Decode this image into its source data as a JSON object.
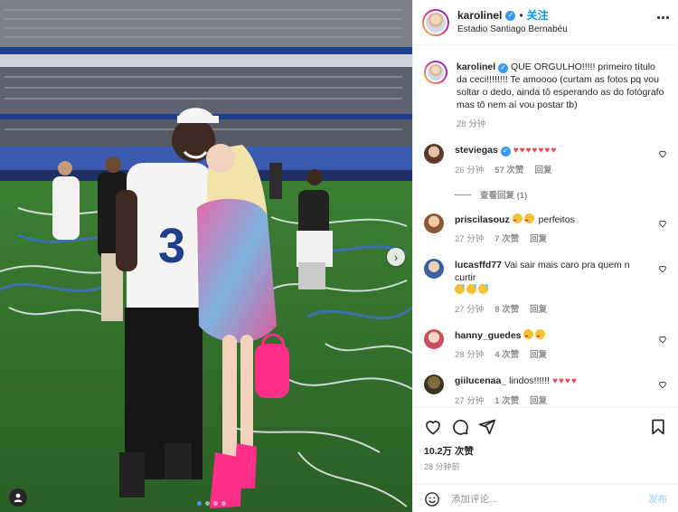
{
  "post": {
    "username": "karolinel",
    "follow_label": "关注",
    "separator": "•",
    "location": "Estadio Santiago Bernabéu"
  },
  "caption": {
    "username": "karolinel",
    "text": "QUE ORGULHO!!!!! primeiro título da ceci!!!!!!!! Te amoooo (curtam as fotos pq vou soltar o dedo, ainda tô esperando as do fotógrafo mas tô nem aí vou postar tb)",
    "time": "28 分钟"
  },
  "comments": [
    {
      "username": "steviegas",
      "text": "♥♥♥♥♥♥♥",
      "time": "26 分钟",
      "likes": "57 次赞",
      "reply": "回复",
      "view_replies": "查看回复 (1)"
    },
    {
      "username": "priscilasouz",
      "text": "perfeitos",
      "time": "27 分钟",
      "likes": "7 次赞",
      "reply": "回复"
    },
    {
      "username": "lucasffd77",
      "text": "Vai sair mais caro pra quem n curtir",
      "time": "27 分钟",
      "likes": "8 次赞",
      "reply": "回复"
    },
    {
      "username": "hanny_guedes",
      "text": "",
      "time": "28 分钟",
      "likes": "4 次赞",
      "reply": "回复"
    },
    {
      "username": "giilucenaa_",
      "text": "lindos!!!!!!",
      "hearts": "♥♥♥♥",
      "time": "27 分钟",
      "likes": "1 次赞",
      "reply": "回复"
    }
  ],
  "actions": {
    "likes": "10.2万 次赞",
    "time": "28 分钟前",
    "comment_placeholder": "添加评论...",
    "post_label": "发布"
  },
  "carousel": {
    "slides": 4,
    "active_index": 0,
    "next_arrow": "›"
  },
  "colors": {
    "accent": "#0095f6",
    "heart": "#ed4956",
    "muted": "#8e8e8e",
    "text": "#262626"
  }
}
